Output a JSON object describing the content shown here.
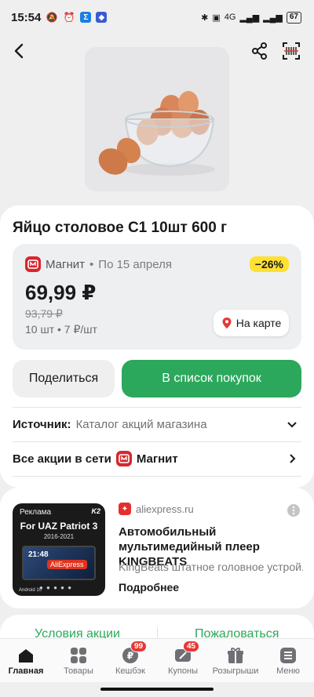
{
  "status": {
    "time": "15:54",
    "network": "4G",
    "battery": "67"
  },
  "product": {
    "title": "Яйцо столовое С1 10шт 600 г"
  },
  "offer": {
    "store": "Магнит",
    "valid_until": "По 15 апреля",
    "discount": "−26%",
    "price": "69,99 ₽",
    "old_price": "93,79 ₽",
    "unit_info": "10 шт • 7 ₽/шт",
    "map_button": "На карте"
  },
  "actions": {
    "share": "Поделиться",
    "add_to_list": "В список покупок"
  },
  "source": {
    "label": "Источник:",
    "value": "Каталог акций магазина"
  },
  "all_offers": {
    "label": "Все акции в сети",
    "store": "Магнит"
  },
  "ad": {
    "label": "Реклама",
    "image_brand": "K2",
    "image_headline": "For UAZ Patriot 3",
    "image_years": "2016-2021",
    "image_time": "21:48",
    "image_badge": "AliExpress",
    "image_os": "Android 10",
    "source": "aliexpress.ru",
    "title": "Автомобильный мультимедийный плеер KINGBEATS",
    "description": "KingBeats штатное головное устрой...",
    "more": "Подробнее"
  },
  "links": {
    "conditions": "Условия акции",
    "complain": "Пожаловаться"
  },
  "tabbar": [
    {
      "label": "Главная",
      "badge": ""
    },
    {
      "label": "Товары",
      "badge": ""
    },
    {
      "label": "Кешбэк",
      "badge": "99"
    },
    {
      "label": "Купоны",
      "badge": "45"
    },
    {
      "label": "Розыгрыши",
      "badge": ""
    },
    {
      "label": "Меню",
      "badge": ""
    }
  ],
  "colors": {
    "accent": "#2ba85b",
    "discount": "#ffe033",
    "store": "#d7262e",
    "badge": "#e53935"
  }
}
